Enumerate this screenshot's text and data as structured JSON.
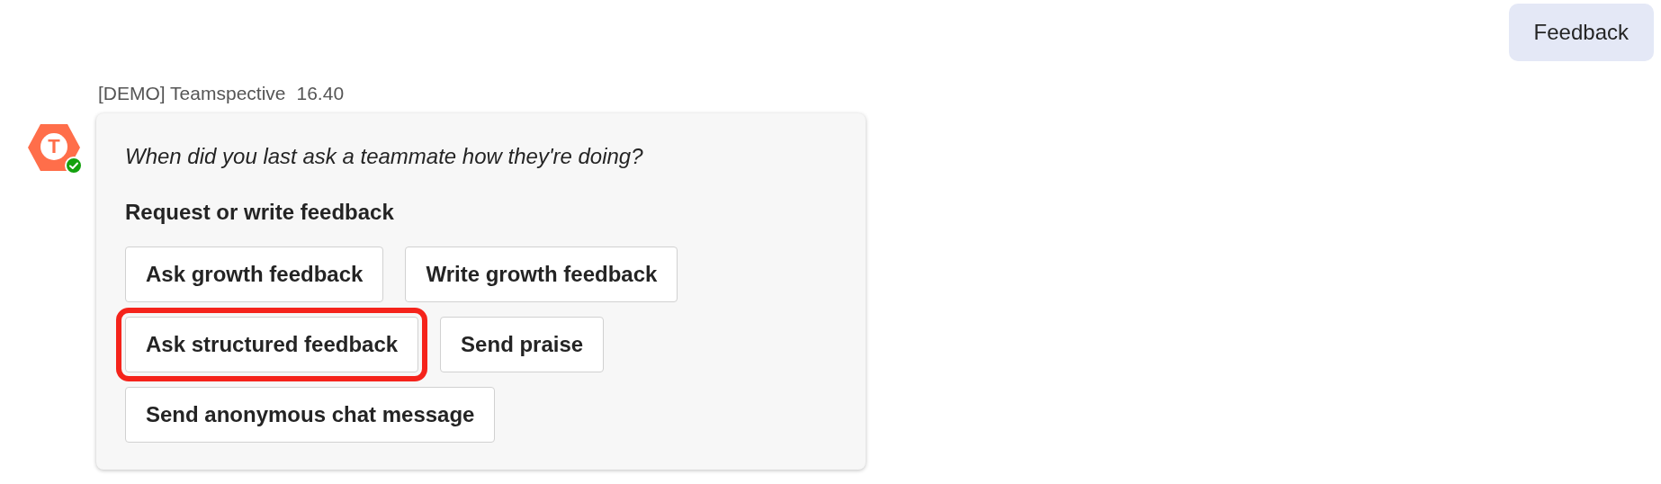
{
  "sent_message": {
    "text": "Feedback"
  },
  "bot_message": {
    "sender": "[DEMO] Teamspective",
    "time": "16.40",
    "avatar_letter": "T",
    "online": true,
    "prompt": "When did you last ask a teammate how they're doing?",
    "heading": "Request or write feedback",
    "button_rows": [
      [
        {
          "label": "Ask growth feedback",
          "highlighted": false
        },
        {
          "label": "Write growth feedback",
          "highlighted": false
        }
      ],
      [
        {
          "label": "Ask structured feedback",
          "highlighted": true
        },
        {
          "label": "Send praise",
          "highlighted": false
        }
      ],
      [
        {
          "label": "Send anonymous chat message",
          "highlighted": false
        }
      ]
    ]
  }
}
